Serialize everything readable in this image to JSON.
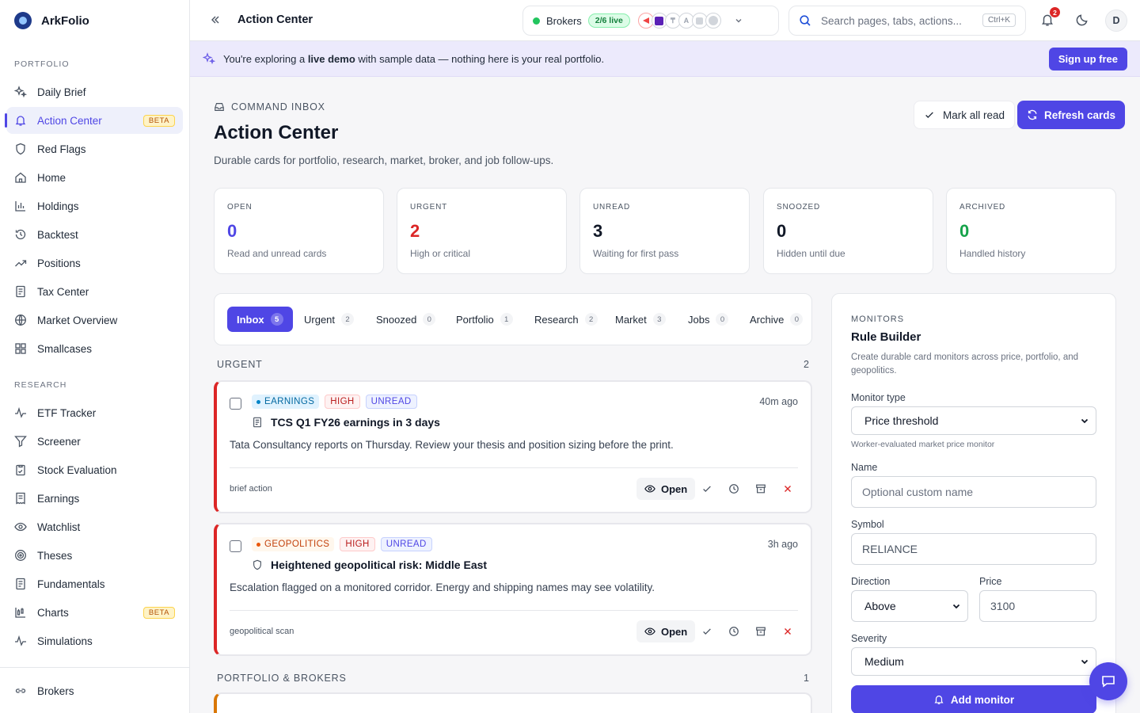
{
  "app": {
    "name": "ArkFolio"
  },
  "sidebar": {
    "sections": [
      {
        "title": "PORTFOLIO",
        "items": [
          {
            "label": "Daily Brief",
            "icon": "sparkle-icon"
          },
          {
            "label": "Action Center",
            "icon": "bell-icon",
            "badge": "BETA",
            "active": true
          },
          {
            "label": "Red Flags",
            "icon": "shield-icon"
          },
          {
            "label": "Home",
            "icon": "home-icon"
          },
          {
            "label": "Holdings",
            "icon": "bar-chart-icon"
          },
          {
            "label": "Backtest",
            "icon": "history-icon"
          },
          {
            "label": "Positions",
            "icon": "trend-icon"
          },
          {
            "label": "Tax Center",
            "icon": "document-icon"
          },
          {
            "label": "Market Overview",
            "icon": "globe-icon"
          },
          {
            "label": "Smallcases",
            "icon": "grid-icon"
          }
        ]
      },
      {
        "title": "RESEARCH",
        "items": [
          {
            "label": "ETF Tracker",
            "icon": "pulse-icon"
          },
          {
            "label": "Screener",
            "icon": "filter-icon"
          },
          {
            "label": "Stock Evaluation",
            "icon": "clipboard-icon"
          },
          {
            "label": "Earnings",
            "icon": "receipt-icon"
          },
          {
            "label": "Watchlist",
            "icon": "eye-icon"
          },
          {
            "label": "Theses",
            "icon": "target-icon"
          },
          {
            "label": "Fundamentals",
            "icon": "document-icon"
          },
          {
            "label": "Charts",
            "icon": "candle-chart-icon",
            "badge": "BETA"
          },
          {
            "label": "Simulations",
            "icon": "pulse-icon"
          }
        ]
      }
    ],
    "bottom": {
      "label": "Brokers",
      "icon": "link-icon"
    }
  },
  "topbar": {
    "title": "Action Center",
    "brokers": {
      "label": "Brokers",
      "live": "2/6 live"
    },
    "search": {
      "placeholder": "Search pages, tabs, actions...",
      "shortcut": "Ctrl+K"
    },
    "notifications": "2",
    "avatar": "D"
  },
  "demo_banner": {
    "pre": "You're exploring a ",
    "bold": "live demo",
    "post": " with sample data — nothing here is your real portfolio.",
    "cta": "Sign up free"
  },
  "header": {
    "eyebrow": "COMMAND INBOX",
    "title": "Action Center",
    "subtitle": "Durable cards for portfolio, research, market, broker, and job follow-ups.",
    "mark_all": "Mark all read",
    "refresh": "Refresh cards"
  },
  "stats": [
    {
      "label": "OPEN",
      "value": "0",
      "desc": "Read and unread cards",
      "color": "#4f46e5"
    },
    {
      "label": "URGENT",
      "value": "2",
      "desc": "High or critical",
      "color": "#dc2626"
    },
    {
      "label": "UNREAD",
      "value": "3",
      "desc": "Waiting for first pass",
      "color": "#111827"
    },
    {
      "label": "SNOOZED",
      "value": "0",
      "desc": "Hidden until due",
      "color": "#111827"
    },
    {
      "label": "ARCHIVED",
      "value": "0",
      "desc": "Handled history",
      "color": "#16a34a"
    }
  ],
  "tabs": [
    {
      "label": "Inbox",
      "count": "5",
      "active": true
    },
    {
      "label": "Urgent",
      "count": "2"
    },
    {
      "label": "Snoozed",
      "count": "0"
    },
    {
      "label": "Portfolio",
      "count": "1"
    },
    {
      "label": "Research",
      "count": "2"
    },
    {
      "label": "Market",
      "count": "3"
    },
    {
      "label": "Jobs",
      "count": "0"
    },
    {
      "label": "Archive",
      "count": "0"
    }
  ],
  "groups": [
    {
      "title": "URGENT",
      "count": "2"
    },
    {
      "title": "PORTFOLIO & BROKERS",
      "count": "1"
    }
  ],
  "cards": [
    {
      "category": "EARNINGS",
      "severity": "HIGH",
      "status": "UNREAD",
      "ago": "40m ago",
      "title": "TCS Q1 FY26 earnings in 3 days",
      "body": "Tata Consultancy reports on Thursday. Review your thesis and position sizing before the print.",
      "source": "brief action",
      "open": "Open"
    },
    {
      "category": "GEOPOLITICS",
      "severity": "HIGH",
      "status": "UNREAD",
      "ago": "3h ago",
      "title": "Heightened geopolitical risk: Middle East",
      "body": "Escalation flagged on a monitored corridor. Energy and shipping names may see volatility.",
      "source": "geopolitical scan",
      "open": "Open"
    }
  ],
  "rule_builder": {
    "eyebrow": "MONITORS",
    "title": "Rule Builder",
    "desc": "Create durable card monitors across price, portfolio, and geopolitics.",
    "monitor_type_label": "Monitor type",
    "monitor_type_value": "Price threshold",
    "monitor_type_hint": "Worker-evaluated market price monitor",
    "name_label": "Name",
    "name_placeholder": "Optional custom name",
    "symbol_label": "Symbol",
    "symbol_value": "RELIANCE",
    "direction_label": "Direction",
    "direction_value": "Above",
    "price_label": "Price",
    "price_value": "3100",
    "severity_label": "Severity",
    "severity_value": "Medium",
    "add_button": "Add monitor"
  }
}
